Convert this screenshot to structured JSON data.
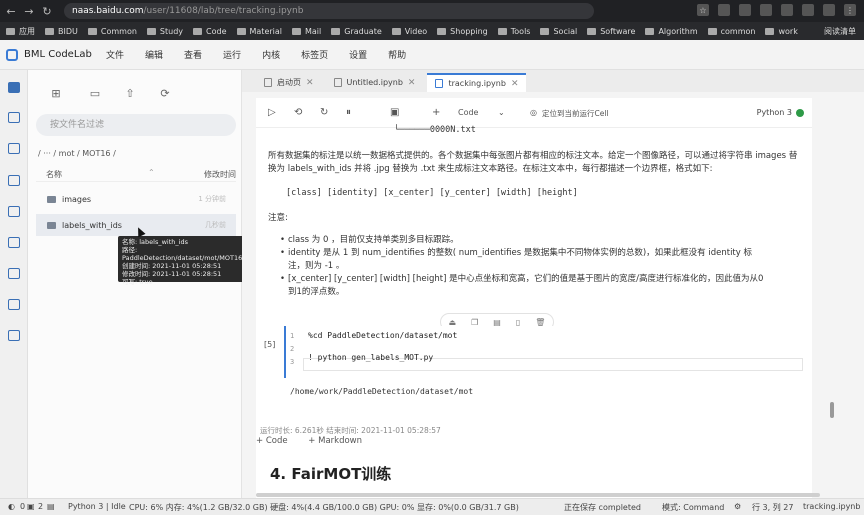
{
  "browser": {
    "url_host": "naas.baidu.com",
    "url_path": "/user/11608/lab/tree/tracking.ipynb",
    "bookmarks": [
      "应用",
      "BIDU",
      "Common",
      "Study",
      "Code",
      "Material",
      "Mail",
      "Graduate",
      "Video",
      "Shopping",
      "Tools",
      "Social",
      "Software",
      "Algorithm",
      "common",
      "work"
    ],
    "reading_list": "阅读清单"
  },
  "app": {
    "name": "BML CodeLab",
    "menu": [
      "文件",
      "编辑",
      "查看",
      "运行",
      "内核",
      "标签页",
      "设置",
      "帮助"
    ]
  },
  "filepanel": {
    "filter_placeholder": "按文件名过滤",
    "breadcrumb": "/ ··· / mot / MOT16 /",
    "col_name": "名称",
    "col_modified": "修改时间",
    "files": [
      {
        "name": "images",
        "time": "1 分钟前"
      },
      {
        "name": "labels_with_ids",
        "time": "几秒前"
      }
    ],
    "tooltip": [
      "名称: labels_with_ids",
      "路径: PaddleDetection/dataset/mot/MOT16",
      "创建时间: 2021-11-01 05:28:51",
      "修改时间: 2021-11-01 05:28:51",
      "可写: true"
    ]
  },
  "tabs": [
    {
      "label": "启动页"
    },
    {
      "label": "Untitled.ipynb"
    },
    {
      "label": "tracking.ipynb"
    }
  ],
  "toolbar": {
    "cell_type": "Code",
    "locate": "定位到当前运行Cell",
    "kernel": "Python 3"
  },
  "notebook": {
    "tree_line": "└──────0000N.txt",
    "para1_line1": "所有数据集的标注是以统一数据格式提供的。各个数据集中每张图片都有相应的标注文本。给定一个图像路径，可以通过将字符串 images 替",
    "para1_line2": "换为 labels_with_ids 并将 .jpg 替换为 .txt 来生成标注文本路径。在标注文本中，每行都描述一个边界框，格式如下:",
    "format": "[class] [identity] [x_center] [y_center] [width] [height]",
    "note": "注意:",
    "bullets": [
      "class 为 0 ，目前仅支持单类别多目标跟踪。",
      "identity 是从 1 到 num_identifies 的整数( num_identifies 是数据集中不同物体实例的总数)，如果此框没有 identity 标",
      "注，则为 -1 。",
      "[x_center] [y_center] [width] [height] 是中心点坐标和宽高，它们的值是基于图片的宽度/高度进行标准化的，因此值为从0",
      "到1的浮点数。"
    ],
    "cell_count": "[5]",
    "code_lines": [
      {
        "n": "1",
        "text": "%cd PaddleDetection/dataset/mot"
      },
      {
        "n": "2",
        "text": ""
      },
      {
        "n": "3",
        "text": "! python gen_labels_MOT.py"
      }
    ],
    "output": "/home/work/PaddleDetection/dataset/mot",
    "run_time": "运行时长: 6.261秒    结束时间: 2021-11-01 05:28:57",
    "add_code": "+ Code",
    "add_markdown": "+ Markdown",
    "heading": "4. FairMOT训练"
  },
  "status": {
    "count_a": "0",
    "count_b": "2",
    "kernel_state": "Python 3 | Idle",
    "resources": "CPU:  6%  内存:  4%(1.2 GB/32.0 GB)  硬盘:  4%(4.4 GB/100.0 GB)  GPU:  0%  显存:  0%(0.0 GB/31.7 GB)",
    "saving": "正在保存 completed",
    "mode": "模式: Command",
    "position": "行 3, 列 27",
    "file": "tracking.ipynb"
  }
}
